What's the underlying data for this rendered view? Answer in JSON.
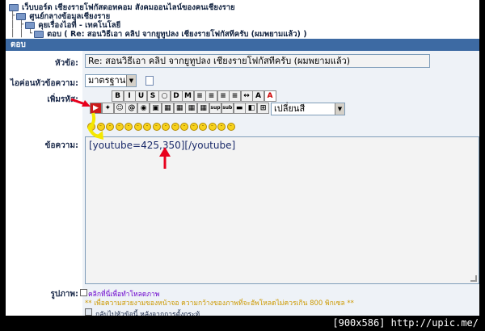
{
  "breadcrumb": [
    {
      "tree": "",
      "label": "เว็บบอร์ด เชียงรายโฟกัสดอทคอม สังคมออนไลน์ของคนเชียงราย"
    },
    {
      "tree": "├",
      "label": "ศูนย์กลางข้อมูลเชียงราย"
    },
    {
      "tree": "│ ├",
      "label": "คุยเรื่องไอที - เทคโนโลยี"
    },
    {
      "tree": "│ │ └",
      "label": "ตอบ ( Re: สอนวิธีเอา คลิป จากยูทูปลง เชียงรายโฟกัสทีครับ (ผมพยามแล้ว) )"
    }
  ],
  "bar_title": "ตอบ",
  "labels": {
    "subject": "หัวข้อ:",
    "icon": "ไอค่อนหัวข้อความ:",
    "codes": "เพิ่มรหัส:",
    "message": "ข้อความ:",
    "image": "รูปภาพ:"
  },
  "subject_value": "Re: สอนวิธีเอา คลิป จากยูทูปลง เชียงรายโฟกัสทีครับ (ผมพยามแล้ว)",
  "icon_select": "มาตรฐาน",
  "color_select": "เปลี่ยนสี",
  "toolbar_row1": [
    "B",
    "I",
    "U",
    "S",
    "○",
    "D",
    "M",
    "≡",
    "≡",
    "≡",
    "≡",
    "↔",
    "A",
    "A"
  ],
  "toolbar_row2": [
    "▶",
    "✦",
    "☺",
    "@",
    "◉",
    "▣",
    "▦",
    "▦",
    "▦",
    "▦",
    "sup",
    "sub",
    "▬",
    "◧",
    "⊞"
  ],
  "message_value": "[youtube=425,350][/youtube]",
  "upload_label": "คลิกที่นี่เพื่อทำโหลดภาพ",
  "upload_note": "** เพื่อความสวยงามของหน้าจอ ความกว้างของภาพที่จะอัพโหลดไม่ควรเกิน 800 พิกเซล **",
  "return_label": "กลับไปหัวข้อนี้ หลังจากการตั้งกระทู้",
  "caption": "[900x586] http://upic.me/",
  "colors": {
    "bar": "#3d6aa3",
    "annot_red": "#e8001c",
    "annot_yellow": "#f4e800"
  }
}
